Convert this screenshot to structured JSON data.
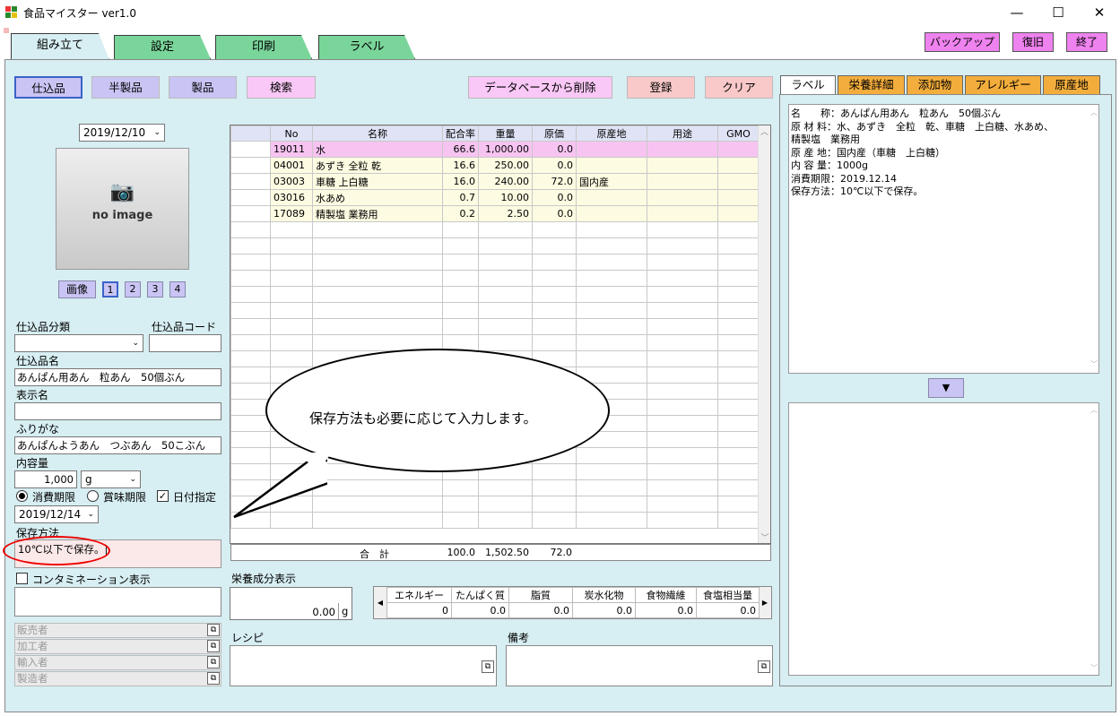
{
  "window": {
    "title": "食品マイスター ver1.0",
    "min": "—",
    "max": "☐",
    "close": "✕"
  },
  "tabs": [
    {
      "label": "組み立て"
    },
    {
      "label": "設定"
    },
    {
      "label": "印刷"
    },
    {
      "label": "ラベル"
    }
  ],
  "top_buttons": {
    "backup": "バックアップ",
    "restore": "復旧",
    "exit": "終了"
  },
  "mode_buttons": {
    "shikomi": "仕込品",
    "hanseihin": "半製品",
    "seihin": "製品",
    "search": "検索"
  },
  "actions": {
    "delete_db": "データベースから削除",
    "register": "登録",
    "clear": "クリア"
  },
  "date": "2019/12/10",
  "no_image": "no image",
  "image_button": "画像",
  "image_pages": [
    "1",
    "2",
    "3",
    "4"
  ],
  "form": {
    "category_label": "仕込品分類",
    "code_label": "仕込品コード",
    "name_label": "仕込品名",
    "name_value": "あんぱん用あん　粒あん　50個ぶん",
    "display_label": "表示名",
    "display_value": "",
    "furigana_label": "ふりがな",
    "furigana_value": "あんぱんようあん　つぶあん　50こぶん",
    "content_label": "内容量",
    "content_value": "1,000",
    "content_unit": "g",
    "expiry_radio": "消費期限",
    "bestbefore_radio": "賞味期限",
    "date_check": "日付指定",
    "expiry_date": "2019/12/14",
    "storage_label": "保存方法",
    "storage_value": "10℃以下で保存。|",
    "contamination_label": "コンタミネーション表示"
  },
  "side_fields": [
    "販売者",
    "加工者",
    "輸入者",
    "製造者"
  ],
  "grid": {
    "headers": [
      "No",
      "名称",
      "配合率",
      "重量",
      "原価",
      "原産地",
      "用途",
      "GMO"
    ],
    "rows": [
      [
        "19011",
        "水",
        "66.6",
        "1,000.00",
        "0.0",
        "",
        "",
        ""
      ],
      [
        "04001",
        "あずき 全粒 乾",
        "16.6",
        "250.00",
        "0.0",
        "",
        "",
        ""
      ],
      [
        "03003",
        "車糖 上白糖",
        "16.0",
        "240.00",
        "72.0",
        "国内産",
        "",
        ""
      ],
      [
        "03016",
        "水あめ",
        "0.7",
        "10.00",
        "0.0",
        "",
        "",
        ""
      ],
      [
        "17089",
        "精製塩 業務用",
        "0.2",
        "2.50",
        "0.0",
        "",
        "",
        ""
      ]
    ],
    "total_label": "合　計",
    "total": [
      "100.0",
      "1,502.50",
      "72.0"
    ]
  },
  "nutrition": {
    "label": "栄養成分表示",
    "amount": "0.00",
    "unit": "g",
    "headers": [
      "エネルギー",
      "たんぱく質",
      "脂質",
      "炭水化物",
      "食物繊維",
      "食塩相当量"
    ],
    "values": [
      "0",
      "0.0",
      "0.0",
      "0.0",
      "0.0",
      "0.0"
    ]
  },
  "recipe_label": "レシピ",
  "notes_label": "備考",
  "right_tabs": [
    "ラベル",
    "栄養詳細",
    "添加物",
    "アレルギー",
    "原産地"
  ],
  "label_text": [
    "名　　称：あんぱん用あん　粒あん　50個ぶん",
    "原 材 料：水、あずき　全粒　乾、車糖　上白糖、水あめ、",
    "精製塩　業務用",
    "原 産 地：国内産（車糖　上白糖）",
    "内 容 量：1000g",
    "消費期限：2019.12.14",
    "保存方法：10℃以下で保存。"
  ],
  "callout": "保存方法も必要に応じて入力します。",
  "colors": {
    "tab_green": "#7ad59a",
    "panel": "#d7eef2",
    "magenta": "#ee82ee",
    "lavender": "#c9c4f4",
    "pink": "#f9c8c8",
    "orange": "#f3ad3c",
    "row_highlight": "#f7c4f2",
    "row_cream": "#fdfbe1"
  }
}
